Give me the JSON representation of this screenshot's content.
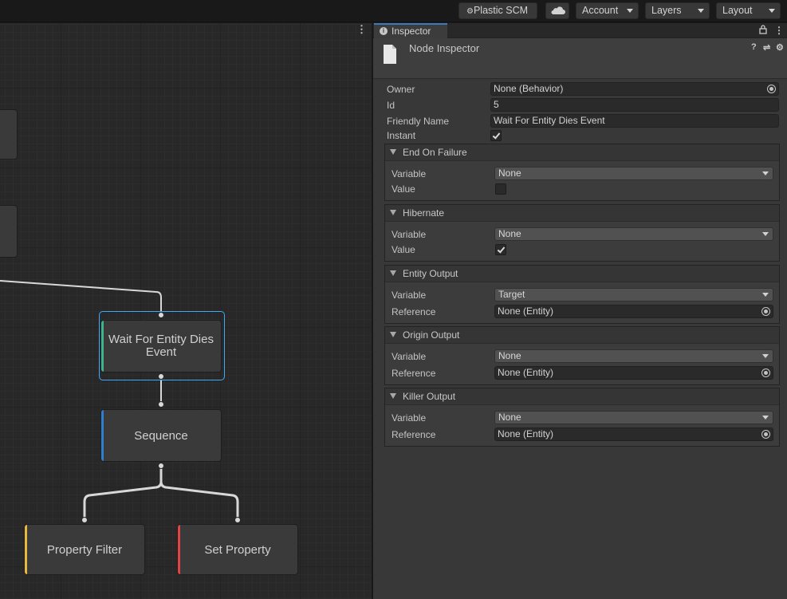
{
  "toolbar": {
    "plastic_scm": "Plastic SCM",
    "account": "Account",
    "layers": "Layers",
    "layout": "Layout"
  },
  "graph": {
    "nodes": {
      "wait": "Wait For Entity Dies Event",
      "sequence": "Sequence",
      "property_filter": "Property Filter",
      "set_property": "Set Property"
    },
    "colors": {
      "wait_stripe": "#3bb58a",
      "sequence_stripe": "#2f7fd1",
      "property_filter_stripe": "#e8b93a",
      "set_property_stripe": "#e04444",
      "selection": "#3fa9f5"
    }
  },
  "inspector": {
    "tab": "Inspector",
    "title": "Node Inspector",
    "fields": {
      "owner_label": "Owner",
      "owner_value": "None (Behavior)",
      "id_label": "Id",
      "id_value": "5",
      "friendly_name_label": "Friendly Name",
      "friendly_name_value": "Wait For Entity Dies Event",
      "instant_label": "Instant",
      "instant_checked": true
    },
    "sections": [
      {
        "title": "End On Failure",
        "variable_label": "Variable",
        "variable": "None",
        "second_label": "Value",
        "value_checked": false
      },
      {
        "title": "Hibernate",
        "variable_label": "Variable",
        "variable": "None",
        "second_label": "Value",
        "value_checked": true
      },
      {
        "title": "Entity Output",
        "variable_label": "Variable",
        "variable": "Target",
        "second_label": "Reference",
        "reference": "None (Entity)"
      },
      {
        "title": "Origin Output",
        "variable_label": "Variable",
        "variable": "None",
        "second_label": "Reference",
        "reference": "None (Entity)"
      },
      {
        "title": "Killer Output",
        "variable_label": "Variable",
        "variable": "None",
        "second_label": "Reference",
        "reference": "None (Entity)"
      }
    ]
  }
}
